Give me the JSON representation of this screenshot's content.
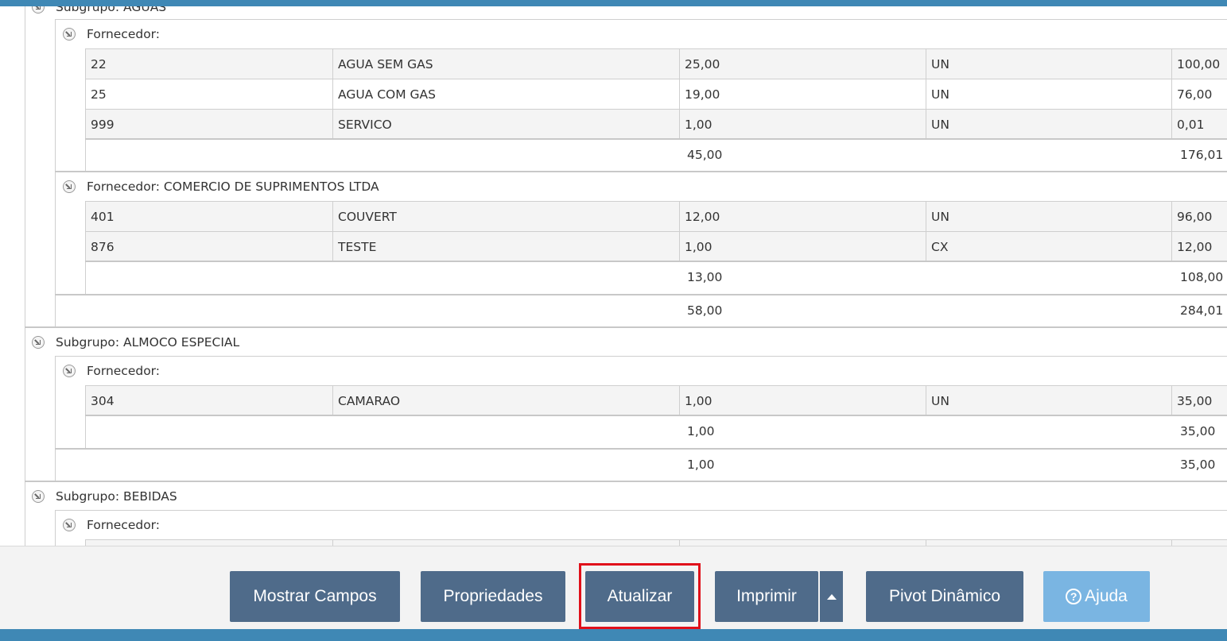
{
  "groups": {
    "aguas": {
      "header": "Subgrupo: AGUAS",
      "f1": {
        "header": "Fornecedor:",
        "rows": [
          [
            "22",
            "AGUA SEM GAS",
            "25,00",
            "UN",
            "100,00"
          ],
          [
            "25",
            "AGUA COM GAS",
            "19,00",
            "UN",
            "76,00"
          ],
          [
            "999",
            "SERVICO",
            "1,00",
            "UN",
            "0,01"
          ]
        ],
        "tot_qty": "45,00",
        "tot_val": "176,01"
      },
      "f2": {
        "header": "Fornecedor: COMERCIO DE SUPRIMENTOS LTDA",
        "rows": [
          [
            "401",
            "COUVERT",
            "12,00",
            "UN",
            "96,00"
          ],
          [
            "876",
            "TESTE",
            "1,00",
            "CX",
            "12,00"
          ]
        ],
        "tot_qty": "13,00",
        "tot_val": "108,00"
      },
      "tot_qty": "58,00",
      "tot_val": "284,01"
    },
    "almoco": {
      "header": "Subgrupo: ALMOCO ESPECIAL",
      "f1": {
        "header": "Fornecedor:",
        "rows": [
          [
            "304",
            "CAMARAO",
            "1,00",
            "UN",
            "35,00"
          ]
        ],
        "tot_qty": "1,00",
        "tot_val": "35,00"
      },
      "tot_qty": "1,00",
      "tot_val": "35,00"
    },
    "bebidas": {
      "header": "Subgrupo: BEBIDAS",
      "f1": {
        "header": "Fornecedor:"
      }
    }
  },
  "toolbar": {
    "mostrar": "Mostrar Campos",
    "propriedades": "Propriedades",
    "atualizar": "Atualizar",
    "imprimir": "Imprimir",
    "pivot": "Pivot Dinâmico",
    "ajuda": "Ajuda"
  },
  "colors": {
    "accent_bar": "#3f88b5",
    "button": "#4f6b8a",
    "button_light": "#7ab5e2",
    "highlight": "#e0101a"
  }
}
